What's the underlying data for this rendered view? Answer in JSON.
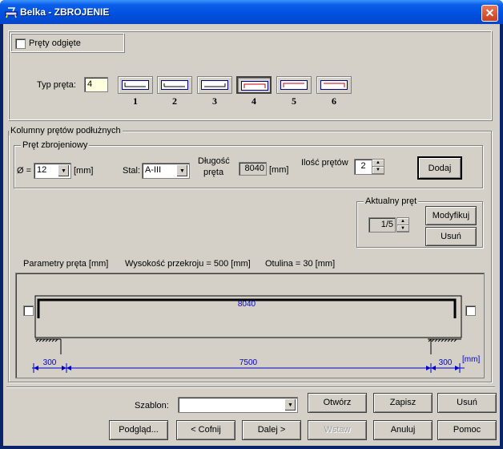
{
  "window": {
    "title": "Belka - ZBROJENIE",
    "close_label": "✕"
  },
  "bent_bars": {
    "label": "Pręty odgięte",
    "checked": false
  },
  "bar_type": {
    "label": "Typ pręta:",
    "value": "4",
    "options": [
      "1",
      "2",
      "3",
      "4",
      "5",
      "6"
    ],
    "selected": "4"
  },
  "longitudinal": {
    "group_label": "Kolumny prętów podłużnych",
    "rebar_group_label": "Pręt zbrojeniowy",
    "diameter_prefix": "Ø =",
    "diameter_value": "12",
    "diameter_unit": "[mm]",
    "steel_label": "Stal:",
    "steel_value": "A-III",
    "length_label_1": "Długość",
    "length_label_2": "pręta",
    "length_value": "8040",
    "length_unit": "[mm]",
    "count_label": "Ilość prętów",
    "count_value": "2",
    "add_button": "Dodaj"
  },
  "current_bar": {
    "group_label": "Aktualny pręt",
    "value": "1/5",
    "modify_button": "Modyfikuj",
    "delete_button": "Usuń"
  },
  "params": {
    "label": "Parametry pręta [mm]",
    "section_height": "Wysokość przekroju = 500 [mm]",
    "cover": "Otulina = 30 [mm]"
  },
  "drawing": {
    "bar_length": "8040",
    "dim_left": "300",
    "dim_mid": "7500",
    "dim_right": "300",
    "dim_unit": "[mm]",
    "bar_color": "#000000",
    "dim_color": "#0000cc"
  },
  "bottom": {
    "template_label": "Szablon:",
    "template_value": "",
    "open_button": "Otwórz",
    "save_button": "Zapisz",
    "delete_button": "Usuń",
    "preview_button": "Podgląd...",
    "back_button": "< Cofnij",
    "next_button": "Dalej >",
    "insert_button": "Wstaw",
    "cancel_button": "Anuluj",
    "help_button": "Pomoc"
  }
}
